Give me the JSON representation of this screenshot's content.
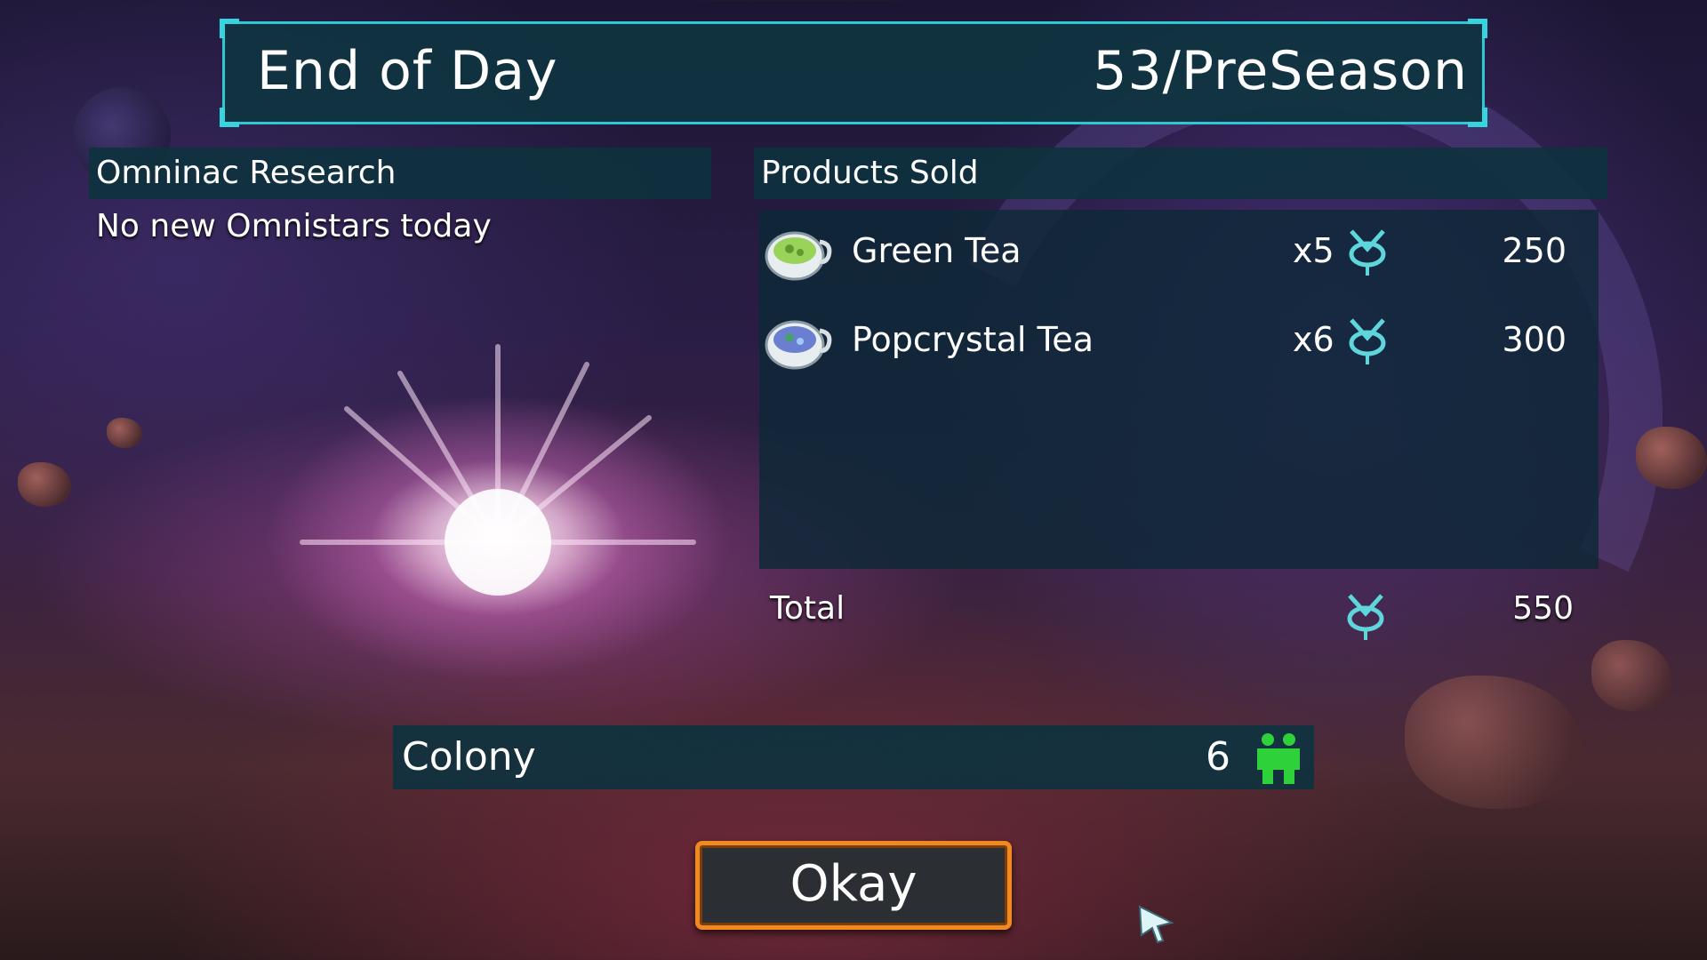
{
  "header": {
    "title": "End of Day",
    "day": "53/PreSeason"
  },
  "research": {
    "title": "Omninac Research",
    "message": "No new Omnistars today"
  },
  "products": {
    "title": "Products Sold",
    "items": [
      {
        "name": "Green Tea",
        "qty": "x5",
        "value": "250",
        "icon": "green-tea-cup-icon",
        "liquid_color": "#9ad35a"
      },
      {
        "name": "Popcrystal Tea",
        "qty": "x6",
        "value": "300",
        "icon": "popcrystal-tea-cup-icon",
        "liquid_color": "#6a7fd0"
      }
    ],
    "total_label": "Total",
    "total_value": "550",
    "currency_icon": "omni-coin-icon"
  },
  "colony": {
    "label": "Colony",
    "count": "6",
    "icon": "colonist-icon",
    "icon_color": "#2fd13a"
  },
  "okay_button": {
    "label": "Okay"
  },
  "colors": {
    "accent": "#2ec7d4",
    "panel": "#0f3240",
    "button_border": "#f08a20",
    "coin": "#5fd5dc"
  }
}
